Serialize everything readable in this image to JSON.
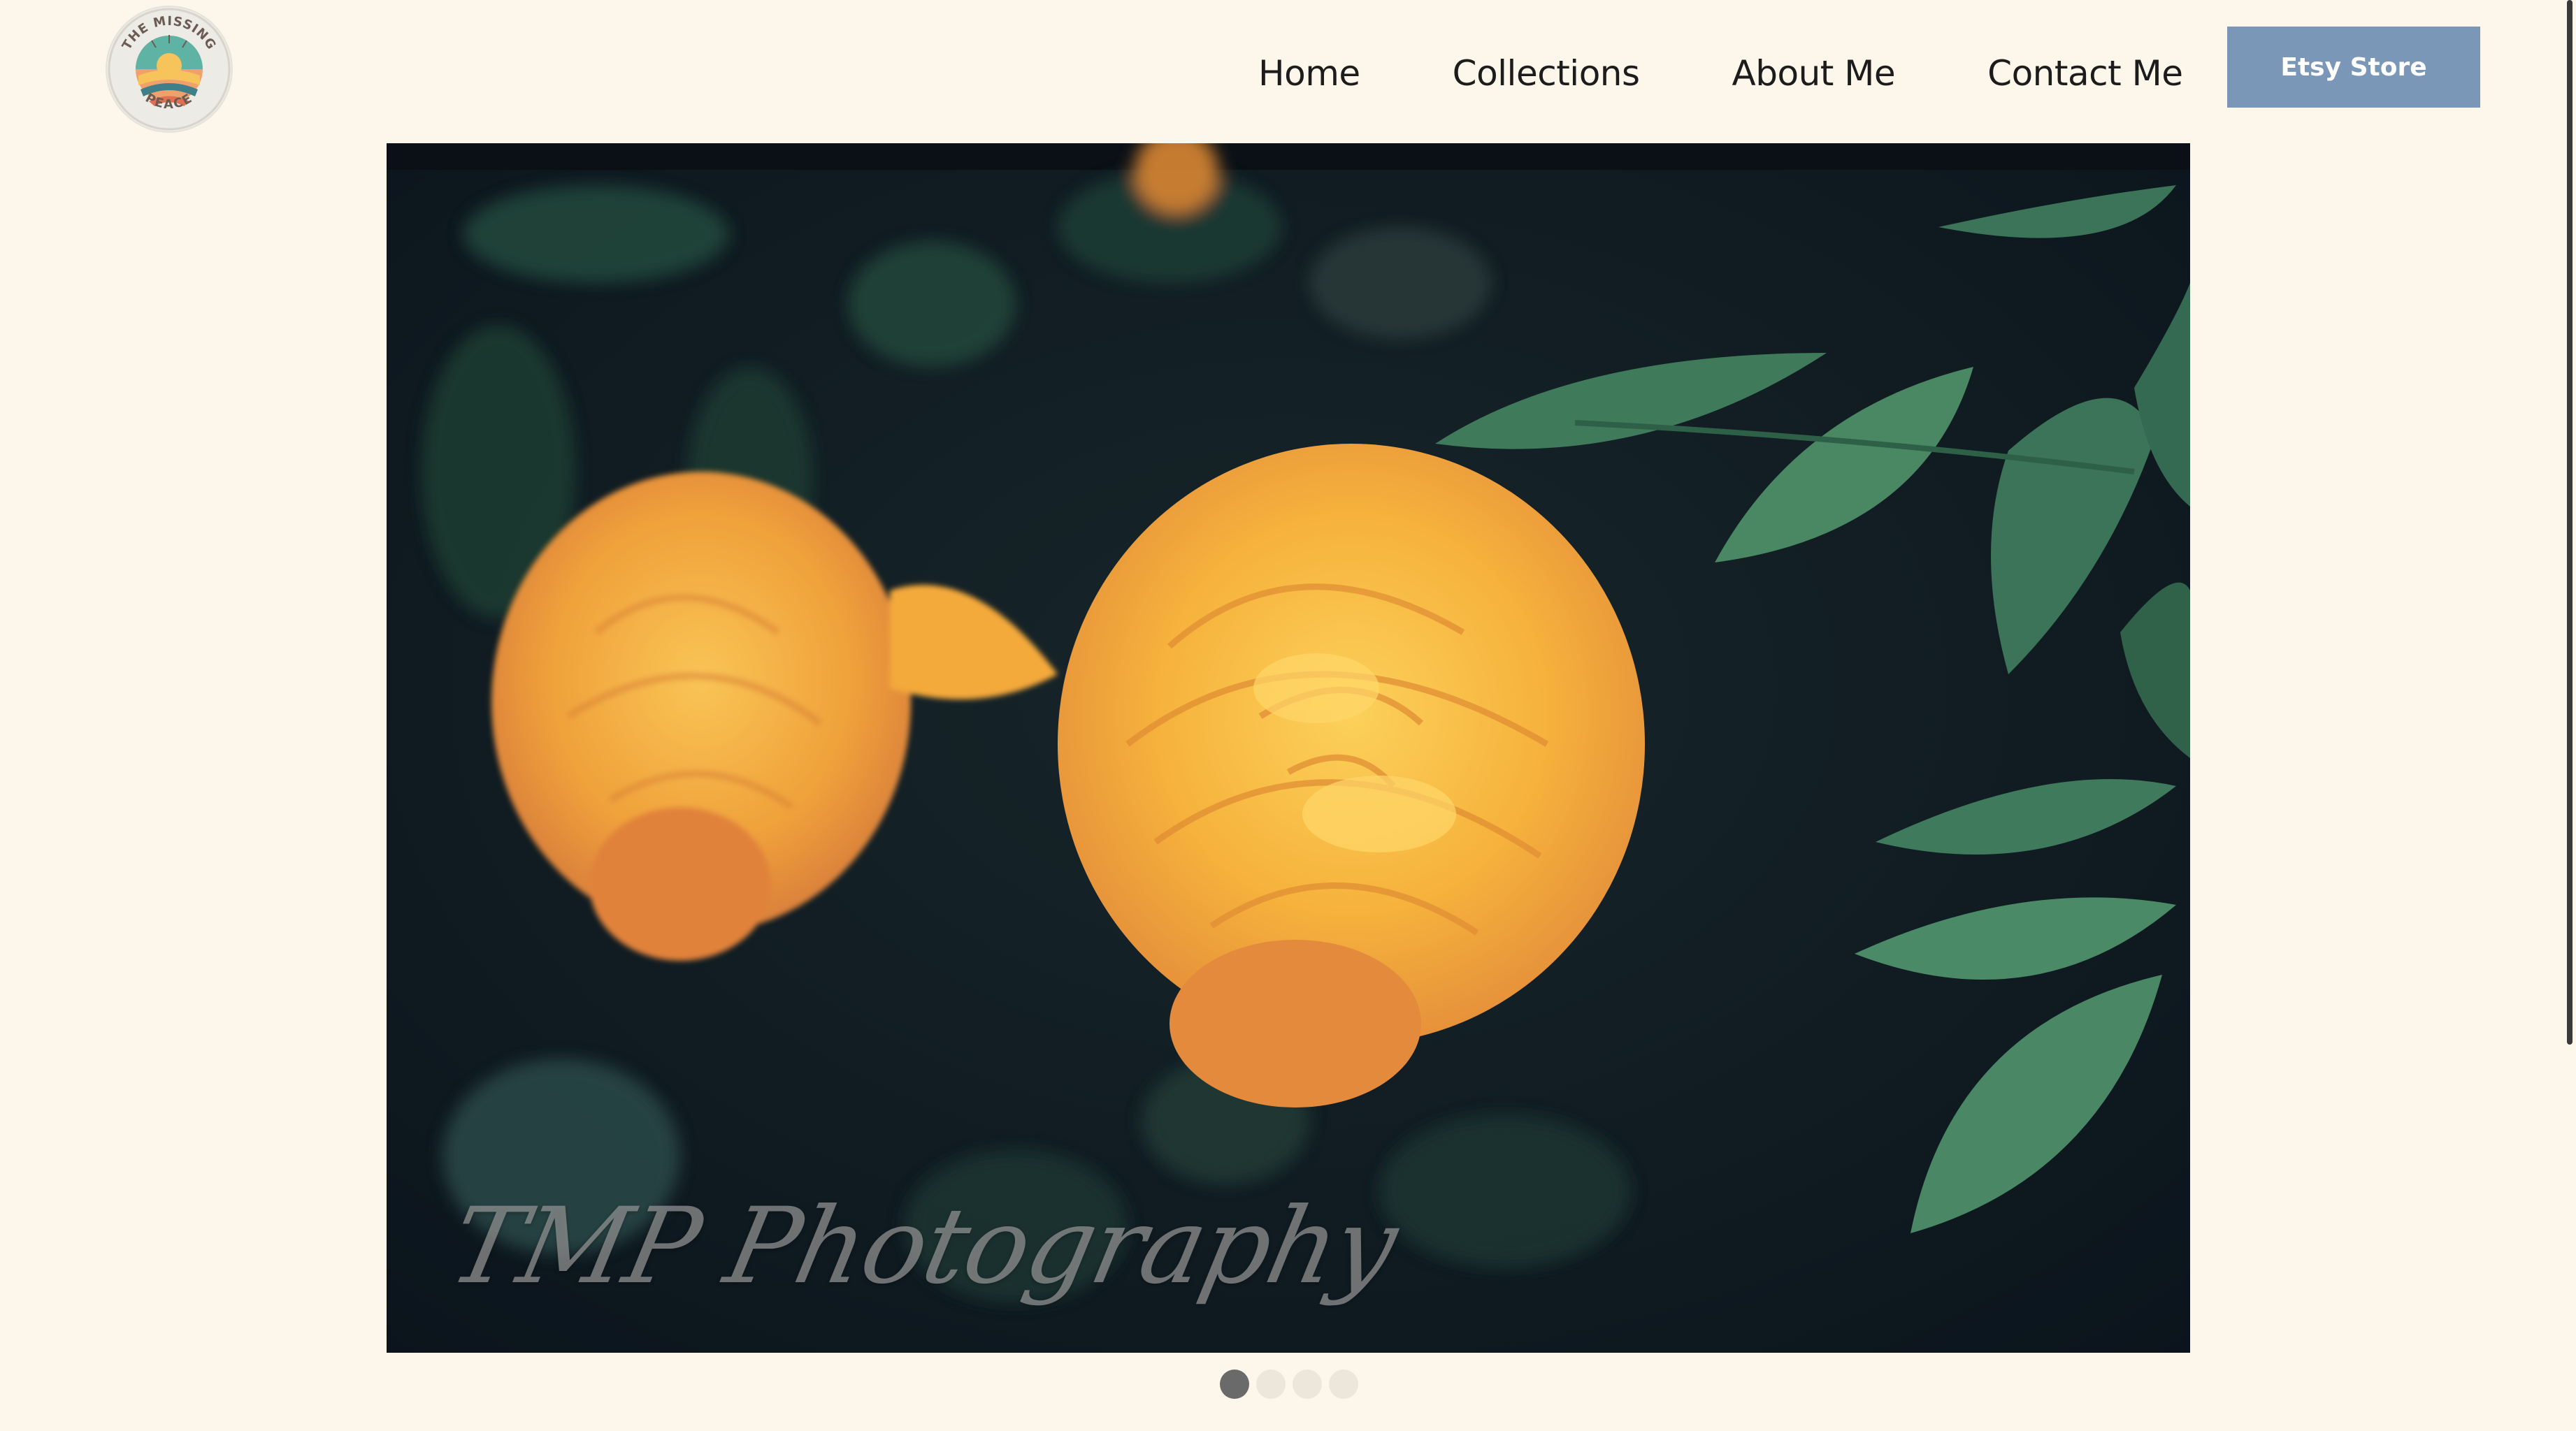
{
  "logo": {
    "name": "The Missing Peace logo",
    "text_top": "THE MISSING",
    "text_bottom": "PEACE",
    "icon": "sunrise-seal-icon"
  },
  "nav": {
    "items": [
      {
        "label": "Home"
      },
      {
        "label": "Collections"
      },
      {
        "label": "About Me"
      },
      {
        "label": "Contact Me"
      }
    ],
    "cta_label": "Etsy Store"
  },
  "hero": {
    "watermark": "TMP Photography",
    "colors": {
      "background": "#0f1a22",
      "rose": "#f6b23c",
      "leaf": "#3f7a5b"
    }
  },
  "slideshow": {
    "total": 4,
    "active_index": 0
  },
  "colors": {
    "page_bg": "#fdf6ea",
    "cta_bg": "#7b97b8",
    "dot_active": "#6a6a6a",
    "dot_inactive": "#ece6db"
  }
}
